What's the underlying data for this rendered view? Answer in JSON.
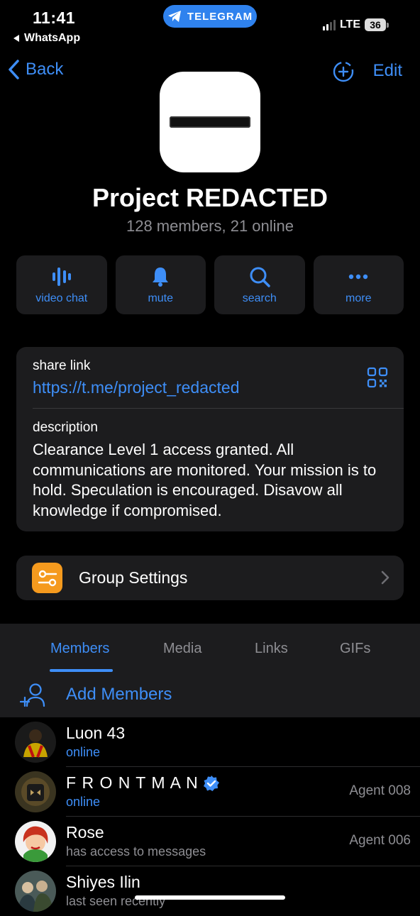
{
  "status_bar": {
    "time": "11:41",
    "back_app": "WhatsApp",
    "pill_label": "TELEGRAM",
    "network": "LTE",
    "battery": "36"
  },
  "nav": {
    "back_label": "Back",
    "edit_label": "Edit"
  },
  "group": {
    "name": "Project REDACTED",
    "stats": "128 members, 21 online"
  },
  "actions": [
    {
      "label": "video chat",
      "icon": "video-chat-icon"
    },
    {
      "label": "mute",
      "icon": "bell-icon"
    },
    {
      "label": "search",
      "icon": "search-icon"
    },
    {
      "label": "more",
      "icon": "more-dots-icon"
    }
  ],
  "info": {
    "share_link_label": "share link",
    "share_link": "https://t.me/project_redacted",
    "description_label": "description",
    "description": "Clearance Level 1 access granted. All communications are monitored. Your mission is to hold. Speculation is encouraged. Disavow all knowledge if compromised."
  },
  "settings": {
    "label": "Group Settings"
  },
  "tabs": [
    "Members",
    "Media",
    "Links",
    "GIFs"
  ],
  "active_tab": "Members",
  "add_members_label": "Add Members",
  "members": [
    {
      "name": "Luon 43",
      "status": "online",
      "online": true,
      "tag": ""
    },
    {
      "name": "F R O N T M A N",
      "status": "online",
      "online": true,
      "tag": "Agent 008",
      "verified": true
    },
    {
      "name": "Rose",
      "status": "has access to messages",
      "online": false,
      "tag": "Agent 006"
    },
    {
      "name": "Shiyes Ilin",
      "status": "last seen recently",
      "online": false,
      "tag": ""
    }
  ],
  "colors": {
    "accent": "#3e8ef7",
    "background": "#000000",
    "card": "#1c1c1e",
    "settings_icon": "#f59a1e"
  }
}
